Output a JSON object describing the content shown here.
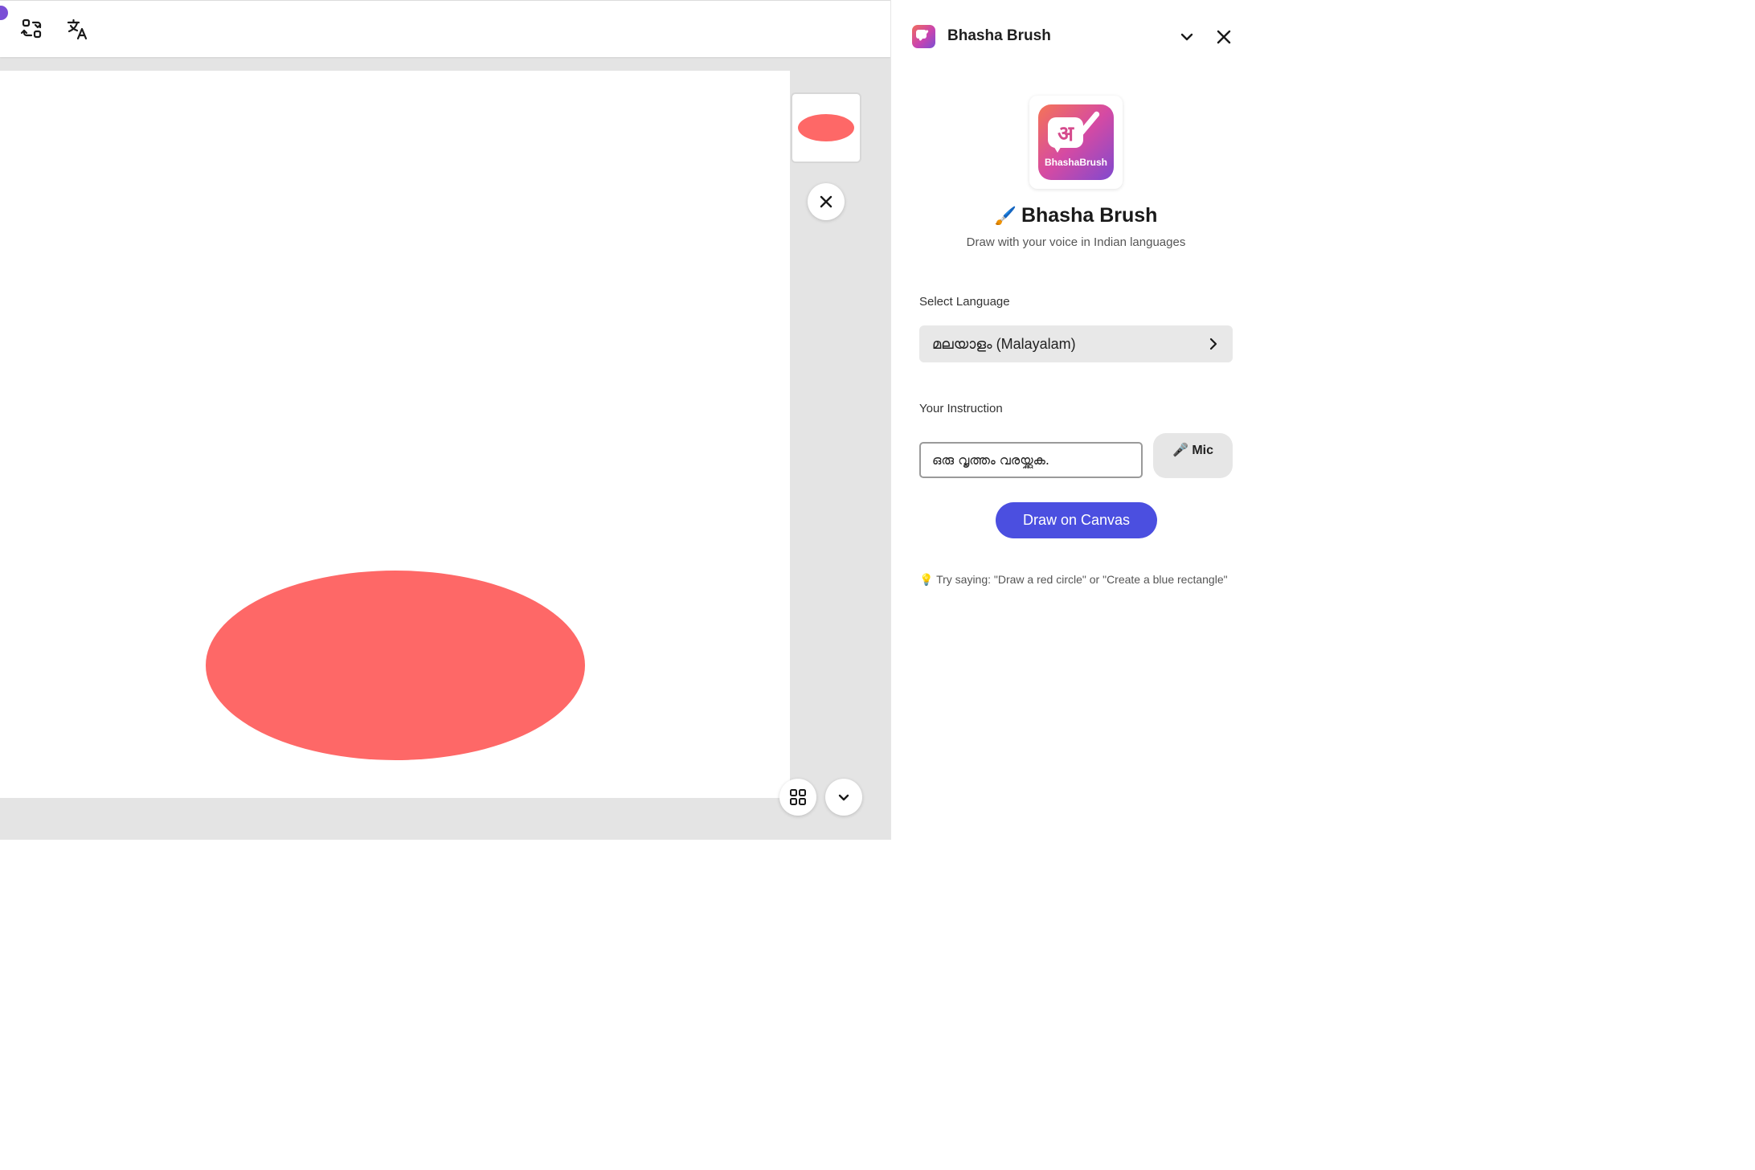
{
  "panel": {
    "title": "Bhasha Brush",
    "logo_brand": "BhashaBrush",
    "logo_glyph": "अ",
    "app_title_icon": "🖌️",
    "app_title": "Bhasha Brush",
    "subtitle": "Draw with your voice in Indian languages",
    "language_label": "Select Language",
    "language_value": "മലയാളം (Malayalam)",
    "instruction_label": "Your Instruction",
    "instruction_value": "ഒരു വൃത്തം വരയ്ക്കുക.",
    "mic_label": "🎤 Mic",
    "draw_button": "Draw on Canvas",
    "tip": "💡 Try saying: \"Draw a red circle\" or \"Create a blue rectangle\""
  },
  "toolbar": {
    "icons": [
      "swap-arrows-icon",
      "translate-icon"
    ]
  },
  "canvas": {
    "shape": "ellipse",
    "fill": "#fe6867"
  },
  "colors": {
    "accent": "#4b4fe0",
    "shape": "#fe6867"
  }
}
